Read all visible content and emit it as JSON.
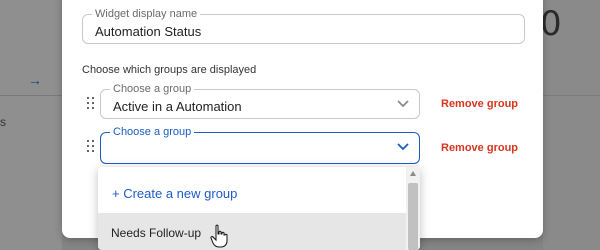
{
  "background": {
    "left_icon": "→",
    "left_text": "s",
    "right_value": "0",
    "plus_symbol": "+"
  },
  "modal": {
    "widget_name_field": {
      "label": "Widget display name",
      "value": "Automation Status"
    },
    "groups_section_label": "Choose which groups are displayed",
    "group_rows": [
      {
        "select_label": "Choose a group",
        "select_value": "Active in a Automation",
        "remove_label": "Remove group"
      },
      {
        "select_label": "Choose a group",
        "select_value": "",
        "remove_label": "Remove group"
      }
    ],
    "dropdown": {
      "create_label": "+ Create a new group",
      "options": [
        {
          "label": "Needs Follow-up"
        }
      ]
    }
  },
  "colors": {
    "accent_blue": "#1d5bc5",
    "remove_red": "#d6361f",
    "overlay_gray": "#858585"
  },
  "icons": {
    "drag": "drag-handle-icon",
    "chevron": "chevron-down-icon",
    "cursor": "hand-pointer-icon"
  }
}
